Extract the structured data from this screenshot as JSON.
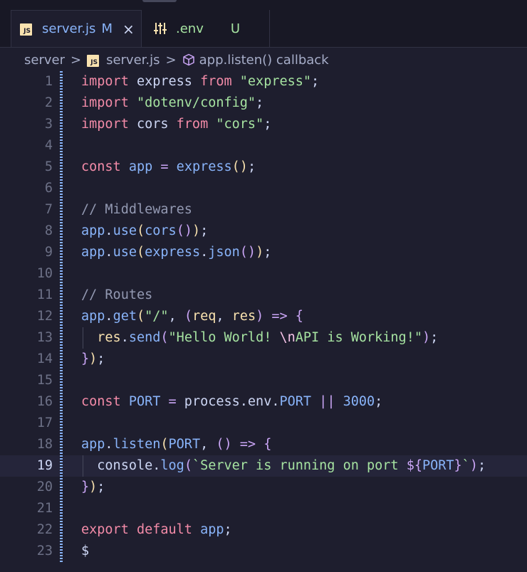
{
  "tabs": {
    "active": {
      "label": "server.js",
      "status": "M",
      "close": "×",
      "icon": "js-file-icon"
    },
    "inactive": {
      "label": ".env",
      "status": "U",
      "icon": "settings-sliders-icon"
    }
  },
  "breadcrumb": {
    "folder": "server",
    "file": "server.js",
    "symbol": "app.listen() callback",
    "separator": ">"
  },
  "current_line": 19,
  "lines": [
    {
      "n": "1",
      "tokens": [
        [
          "kw",
          "import"
        ],
        [
          "id",
          " express "
        ],
        [
          "kw",
          "from"
        ],
        [
          "str",
          " \"express\""
        ],
        [
          "pun",
          ";"
        ]
      ]
    },
    {
      "n": "2",
      "tokens": [
        [
          "kw",
          "import"
        ],
        [
          "str",
          " \"dotenv/config\""
        ],
        [
          "pun",
          ";"
        ]
      ]
    },
    {
      "n": "3",
      "tokens": [
        [
          "kw",
          "import"
        ],
        [
          "id",
          " cors "
        ],
        [
          "kw",
          "from"
        ],
        [
          "str",
          " \"cors\""
        ],
        [
          "pun",
          ";"
        ]
      ]
    },
    {
      "n": "4",
      "tokens": []
    },
    {
      "n": "5",
      "tokens": [
        [
          "kw",
          "const"
        ],
        [
          "var",
          " app "
        ],
        [
          "op",
          "="
        ],
        [
          "fn",
          " express"
        ],
        [
          "par",
          "()"
        ],
        [
          "pun",
          ";"
        ]
      ]
    },
    {
      "n": "6",
      "tokens": []
    },
    {
      "n": "7",
      "tokens": [
        [
          "cmt",
          "// Middlewares"
        ]
      ]
    },
    {
      "n": "8",
      "tokens": [
        [
          "var",
          "app"
        ],
        [
          "pun",
          "."
        ],
        [
          "fn",
          "use"
        ],
        [
          "par",
          "("
        ],
        [
          "fn",
          "cors"
        ],
        [
          "br2",
          "()"
        ],
        [
          "par",
          ")"
        ],
        [
          "pun",
          ";"
        ]
      ]
    },
    {
      "n": "9",
      "tokens": [
        [
          "var",
          "app"
        ],
        [
          "pun",
          "."
        ],
        [
          "fn",
          "use"
        ],
        [
          "par",
          "("
        ],
        [
          "var",
          "express"
        ],
        [
          "pun",
          "."
        ],
        [
          "fn",
          "json"
        ],
        [
          "br2",
          "()"
        ],
        [
          "par",
          ")"
        ],
        [
          "pun",
          ";"
        ]
      ]
    },
    {
      "n": "10",
      "tokens": []
    },
    {
      "n": "11",
      "tokens": [
        [
          "cmt",
          "// Routes"
        ]
      ]
    },
    {
      "n": "12",
      "tokens": [
        [
          "var",
          "app"
        ],
        [
          "pun",
          "."
        ],
        [
          "fn",
          "get"
        ],
        [
          "par",
          "("
        ],
        [
          "str",
          "\"/\""
        ],
        [
          "pun",
          ", "
        ],
        [
          "br2",
          "("
        ],
        [
          "par",
          "req"
        ],
        [
          "pun",
          ", "
        ],
        [
          "par",
          "res"
        ],
        [
          "br2",
          ")"
        ],
        [
          "op",
          " =>"
        ],
        [
          "pun",
          " "
        ],
        [
          "br2",
          "{"
        ]
      ]
    },
    {
      "n": "13",
      "tokens": [
        [
          "pun",
          "  "
        ],
        [
          "par",
          "res"
        ],
        [
          "pun",
          "."
        ],
        [
          "fn",
          "send"
        ],
        [
          "br2",
          "("
        ],
        [
          "str",
          "\"Hello World! "
        ],
        [
          "esc",
          "\\n"
        ],
        [
          "str",
          "API is Working!\""
        ],
        [
          "br2",
          ")"
        ],
        [
          "pun",
          ";"
        ]
      ]
    },
    {
      "n": "14",
      "tokens": [
        [
          "br2",
          "}"
        ],
        [
          "par",
          ")"
        ],
        [
          "pun",
          ";"
        ]
      ]
    },
    {
      "n": "15",
      "tokens": []
    },
    {
      "n": "16",
      "tokens": [
        [
          "kw",
          "const"
        ],
        [
          "var",
          " PORT "
        ],
        [
          "op",
          "="
        ],
        [
          "id",
          " process"
        ],
        [
          "pun",
          "."
        ],
        [
          "id",
          "env"
        ],
        [
          "pun",
          "."
        ],
        [
          "var",
          "PORT"
        ],
        [
          "op",
          " ||"
        ],
        [
          "num",
          " 3000"
        ],
        [
          "pun",
          ";"
        ]
      ]
    },
    {
      "n": "17",
      "tokens": []
    },
    {
      "n": "18",
      "tokens": [
        [
          "var",
          "app"
        ],
        [
          "pun",
          "."
        ],
        [
          "fn",
          "listen"
        ],
        [
          "par",
          "("
        ],
        [
          "var",
          "PORT"
        ],
        [
          "pun",
          ", "
        ],
        [
          "br2",
          "()"
        ],
        [
          "op",
          " =>"
        ],
        [
          "pun",
          " "
        ],
        [
          "br2",
          "{"
        ]
      ]
    },
    {
      "n": "19",
      "tokens": [
        [
          "pun",
          "  "
        ],
        [
          "id",
          "console"
        ],
        [
          "pun",
          "."
        ],
        [
          "fn",
          "log"
        ],
        [
          "br2",
          "("
        ],
        [
          "str",
          "`Server is running on port "
        ],
        [
          "tpl",
          "${"
        ],
        [
          "var",
          "PORT"
        ],
        [
          "tpl",
          "}"
        ],
        [
          "str",
          "`"
        ],
        [
          "br2",
          ")"
        ],
        [
          "pun",
          ";"
        ]
      ]
    },
    {
      "n": "20",
      "tokens": [
        [
          "br2",
          "}"
        ],
        [
          "par",
          ")"
        ],
        [
          "pun",
          ";"
        ]
      ]
    },
    {
      "n": "21",
      "tokens": []
    },
    {
      "n": "22",
      "tokens": [
        [
          "kw",
          "export"
        ],
        [
          "kw",
          " default"
        ],
        [
          "var",
          " app"
        ],
        [
          "pun",
          ";"
        ]
      ]
    },
    {
      "n": "23",
      "tokens": [
        [
          "id",
          "$"
        ]
      ]
    }
  ]
}
